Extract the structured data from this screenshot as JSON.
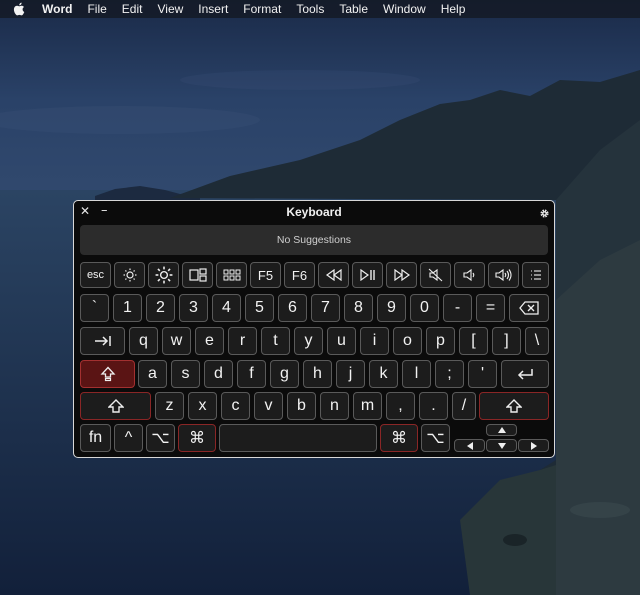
{
  "menubar": {
    "app_name": "Word",
    "items": [
      "File",
      "Edit",
      "View",
      "Insert",
      "Format",
      "Tools",
      "Table",
      "Window",
      "Help"
    ]
  },
  "keyboard_window": {
    "title": "Keyboard",
    "suggestion": "No Suggestions"
  },
  "keys": {
    "esc": "esc",
    "f5": "F5",
    "f6": "F6",
    "num_row": [
      "`",
      "1",
      "2",
      "3",
      "4",
      "5",
      "6",
      "7",
      "8",
      "9",
      "0",
      "-",
      "="
    ],
    "top_row": [
      "q",
      "w",
      "e",
      "r",
      "t",
      "y",
      "u",
      "i",
      "o",
      "p",
      "[",
      "]",
      "\\"
    ],
    "home_row": [
      "a",
      "s",
      "d",
      "f",
      "g",
      "h",
      "j",
      "k",
      "l",
      ";",
      "'"
    ],
    "bottom_row": [
      "z",
      "x",
      "c",
      "v",
      "b",
      "n",
      "m",
      ",",
      ".",
      "/"
    ],
    "fn": "fn",
    "control": "^",
    "option": "⌥",
    "command": "⌘"
  },
  "icons": {
    "apple": "apple-logo-icon",
    "close": "close-icon",
    "minimize": "minimize-icon",
    "settings": "gear-icon"
  }
}
